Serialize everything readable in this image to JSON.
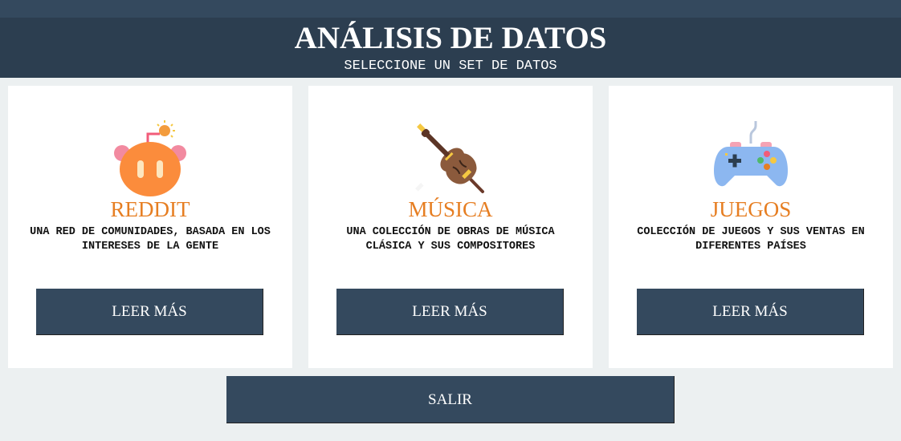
{
  "header": {
    "title": "ANÁLISIS DE DATOS",
    "subtitle": "SELECCIONE UN SET DE DATOS"
  },
  "cards": [
    {
      "title": "REDDIT",
      "description": "UNA RED DE COMUNIDADES, BASADA EN LOS INTERESES DE LA GENTE",
      "button_label": "LEER MÁS",
      "icon": "reddit-robot-icon"
    },
    {
      "title": "MÚSICA",
      "description": "UNA COLECCIÓN DE OBRAS DE MÚSICA CLÁSICA Y SUS COMPOSITORES",
      "button_label": "LEER MÁS",
      "icon": "violin-icon"
    },
    {
      "title": "JUEGOS",
      "description": "COLECCIÓN DE JUEGOS Y SUS VENTAS EN DIFERENTES PAÍSES",
      "button_label": "LEER MÁS",
      "icon": "gamepad-icon"
    }
  ],
  "exit_button": {
    "label": "SALIR"
  },
  "colors": {
    "header_bg": "#2c3e50",
    "button_bg": "#34495e",
    "accent": "#e67e22",
    "page_bg": "#ecf0f1"
  }
}
